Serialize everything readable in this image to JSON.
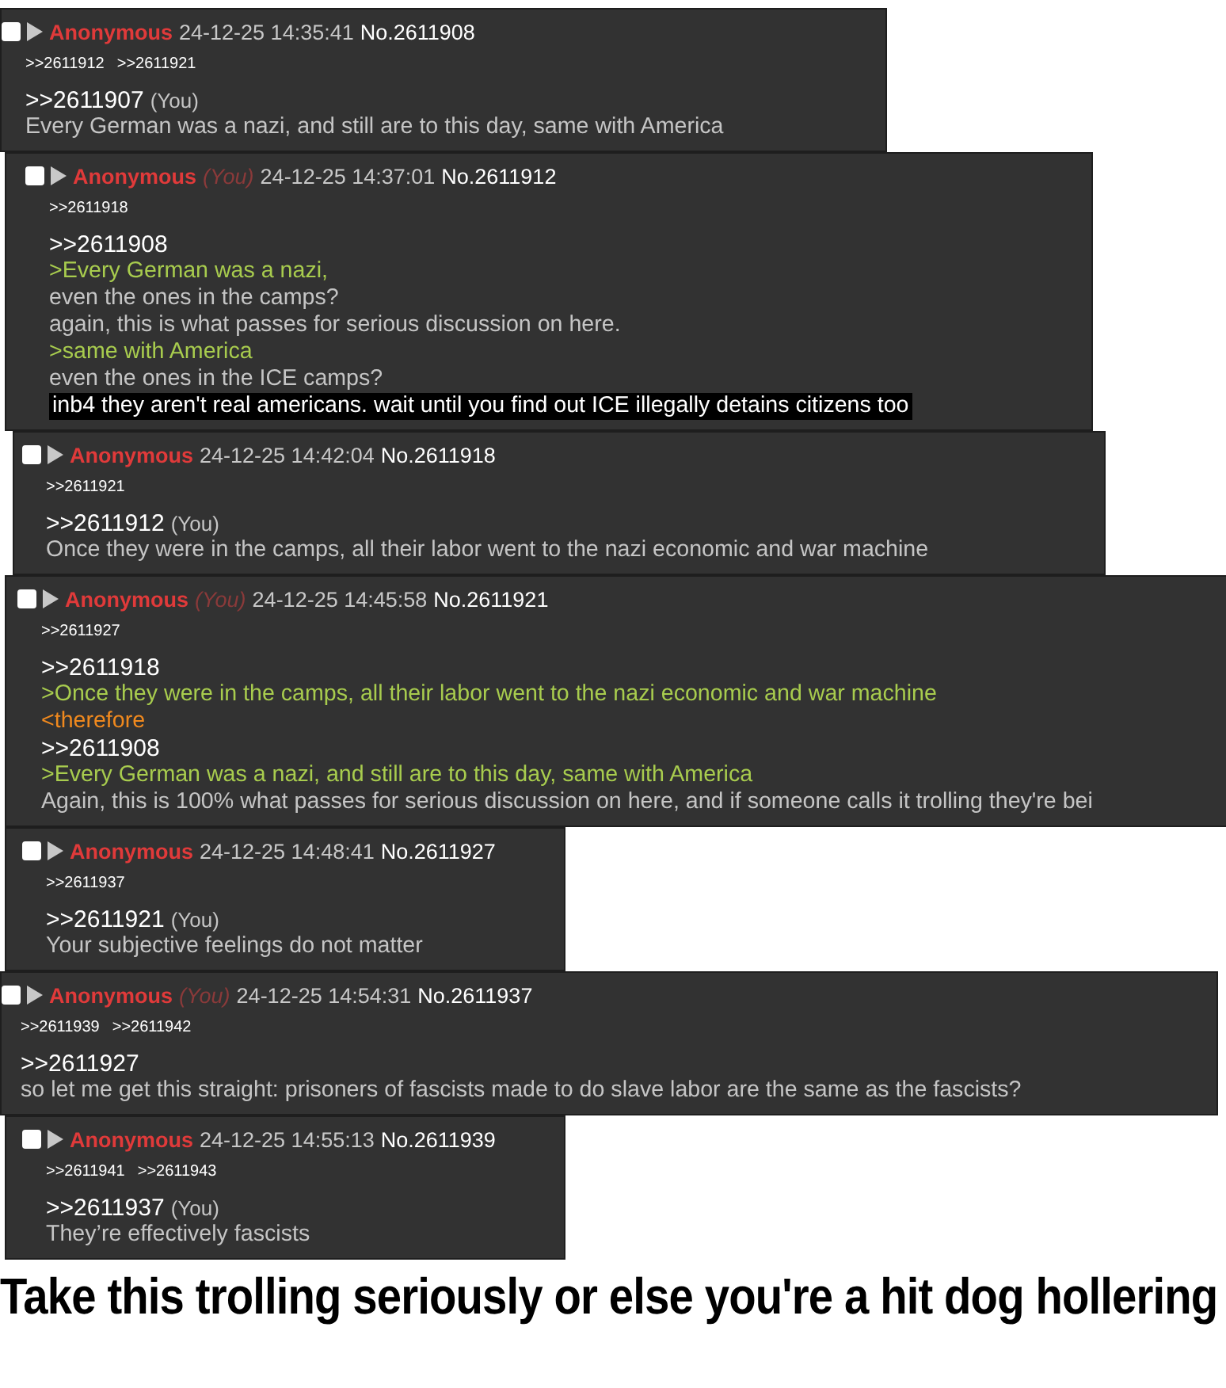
{
  "posts": [
    {
      "checked": false,
      "name": "Anonymous",
      "date": "24-12-25 14:35:41",
      "number": "No.2611908",
      "backlinks": [
        ">>2611912",
        ">>2611921"
      ],
      "lines": [
        {
          "kind": "quotelink",
          "text": ">>2611907",
          "you_mark": "(You)"
        },
        {
          "kind": "text",
          "text": "Every German was a nazi, and still are to this day, same with America"
        }
      ]
    },
    {
      "checked": false,
      "name": "Anonymous",
      "you_label": "(You)",
      "date": "24-12-25 14:37:01",
      "number": "No.2611912",
      "backlinks": [
        ">>2611918"
      ],
      "lines": [
        {
          "kind": "quotelink",
          "text": ">>2611908"
        },
        {
          "kind": "greentext",
          "text": ">Every German was a nazi,"
        },
        {
          "kind": "text",
          "text": "even the ones in the camps?"
        },
        {
          "kind": "text",
          "text": "again, this is what passes for serious discussion on here."
        },
        {
          "kind": "greentext",
          "text": ">same with America"
        },
        {
          "kind": "text",
          "text": "even the ones in the ICE camps?"
        },
        {
          "kind": "highlight",
          "text": "inb4 they aren't real americans. wait until you find out ICE illegally detains citizens too"
        }
      ]
    },
    {
      "checked": false,
      "name": "Anonymous",
      "date": "24-12-25 14:42:04",
      "number": "No.2611918",
      "backlinks": [
        ">>2611921"
      ],
      "lines": [
        {
          "kind": "quotelink",
          "text": ">>2611912",
          "you_mark": "(You)"
        },
        {
          "kind": "text",
          "text": "Once they were in the camps, all their labor went to the nazi economic and war machine"
        }
      ]
    },
    {
      "checked": false,
      "name": "Anonymous",
      "you_label": "(You)",
      "date": "24-12-25 14:45:58",
      "number": "No.2611921",
      "backlinks": [
        ">>2611927"
      ],
      "lines": [
        {
          "kind": "quotelink",
          "text": ">>2611918"
        },
        {
          "kind": "greentext",
          "text": ">Once they were in the camps, all their labor went to the nazi economic and war machine"
        },
        {
          "kind": "orangetext",
          "text": "<therefore"
        },
        {
          "kind": "quotelink",
          "text": ">>2611908"
        },
        {
          "kind": "greentext",
          "text": ">Every German was a nazi, and still are to this day, same with America"
        },
        {
          "kind": "text",
          "text": "Again, this is 100% what passes for serious discussion on here, and if someone calls it trolling they're bei"
        }
      ]
    },
    {
      "checked": false,
      "name": "Anonymous",
      "date": "24-12-25 14:48:41",
      "number": "No.2611927",
      "backlinks": [
        ">>2611937"
      ],
      "lines": [
        {
          "kind": "quotelink",
          "text": ">>2611921",
          "you_mark": "(You)"
        },
        {
          "kind": "text",
          "text": "Your subjective feelings do not matter"
        }
      ]
    },
    {
      "checked": false,
      "name": "Anonymous",
      "you_label": "(You)",
      "date": "24-12-25 14:54:31",
      "number": "No.2611937",
      "backlinks": [
        ">>2611939",
        ">>2611942"
      ],
      "lines": [
        {
          "kind": "quotelink",
          "text": ">>2611927"
        },
        {
          "kind": "text",
          "text": "so let me get this straight: prisoners of fascists made to do slave labor are the same as the fascists?"
        }
      ]
    },
    {
      "checked": false,
      "name": "Anonymous",
      "date": "24-12-25 14:55:13",
      "number": "No.2611939",
      "backlinks": [
        ">>2611941",
        ">>2611943"
      ],
      "lines": [
        {
          "kind": "quotelink",
          "text": ">>2611937",
          "you_mark": "(You)"
        },
        {
          "kind": "text",
          "text": "They’re effectively fascists"
        }
      ]
    }
  ],
  "caption": "Take this trolling seriously or else you're a hit dog hollering"
}
